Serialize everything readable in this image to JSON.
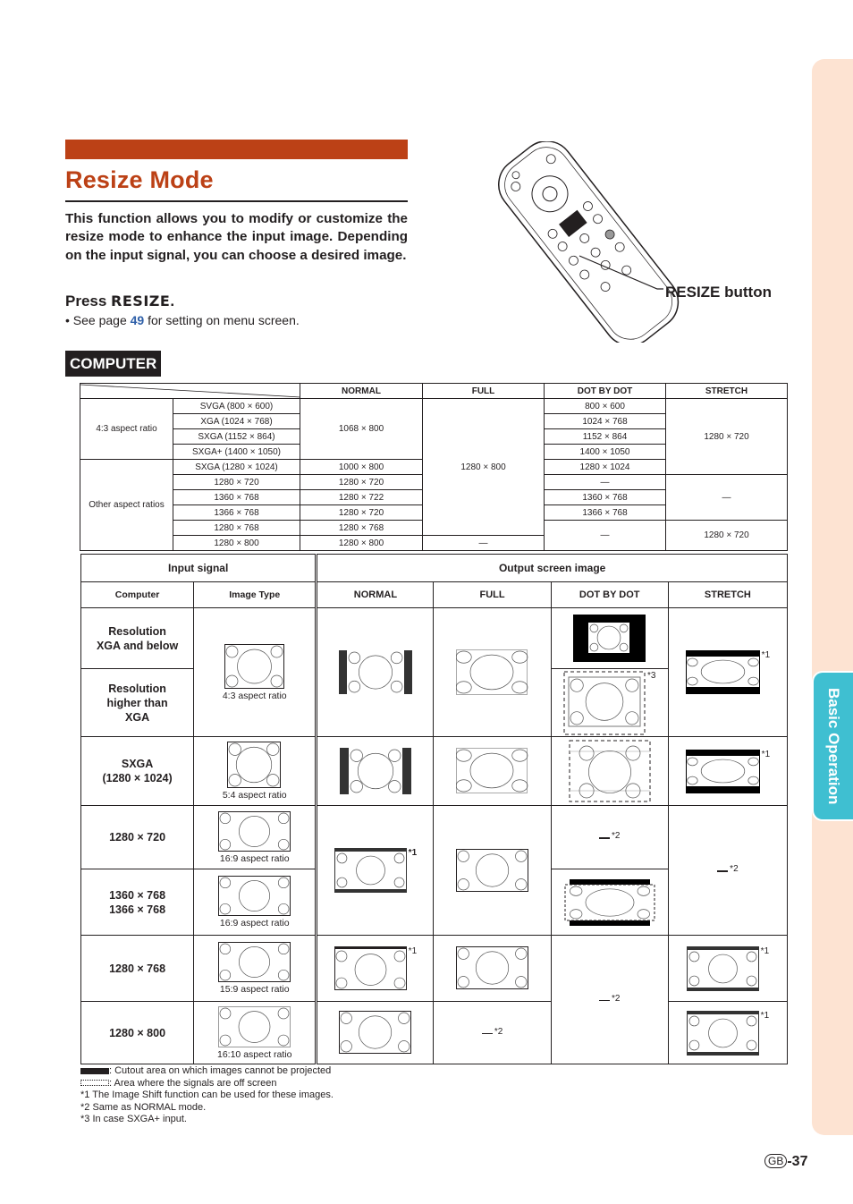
{
  "page": {
    "title": "Resize Mode",
    "intro": "This function allows you to modify or customize the resize mode to enhance the input image. Depending on the input signal, you can choose a desired image.",
    "press_prefix": "Press ",
    "press_key": "RESIZE",
    "press_suffix": ".",
    "see_prefix": "• See page ",
    "see_page": "49",
    "see_suffix": " for setting on menu screen.",
    "remote_callout": "RESIZE button",
    "section_label": "COMPUTER",
    "side_tab": "Basic Operation",
    "page_region": "GB",
    "page_number": "-37",
    "colors": {
      "accent": "#bc4116",
      "tab": "#3fbfd1",
      "tab_bg": "#fde3d2",
      "link": "#2e5fa8"
    }
  },
  "spec_table": {
    "headers": [
      "NORMAL",
      "FULL",
      "DOT BY DOT",
      "STRETCH"
    ],
    "groups": [
      {
        "label": "4:3 aspect ratio",
        "rows": [
          {
            "signal": "SVGA (800 × 600)",
            "normal": "1068 × 800",
            "dot": "800 × 600",
            "stretch": "1280 × 720"
          },
          {
            "signal": "XGA (1024 × 768)",
            "dot": "1024 × 768"
          },
          {
            "signal": "SXGA (1152 × 864)",
            "dot": "1152 × 864"
          },
          {
            "signal": "SXGA+ (1400 × 1050)",
            "dot": "1400 × 1050"
          }
        ]
      },
      {
        "label": "Other aspect ratios",
        "rows": [
          {
            "signal": "SXGA (1280 × 1024)",
            "normal": "1000 × 800",
            "dot": "1280 × 1024"
          },
          {
            "signal": "1280 × 720",
            "normal": "1280 × 720",
            "dot": "—",
            "stretch": "—"
          },
          {
            "signal": "1360 × 768",
            "normal": "1280 × 722",
            "dot": "1360 × 768"
          },
          {
            "signal": "1366 × 768",
            "normal": "1280 × 720",
            "dot": "1366 × 768"
          },
          {
            "signal": "1280 × 768",
            "normal": "1280 × 768",
            "dot": "—",
            "stretch": "1280 × 720"
          },
          {
            "signal": "1280 × 800",
            "normal": "1280 × 800",
            "full": "—"
          }
        ]
      }
    ],
    "full_merged": "1280 × 800"
  },
  "image_table": {
    "input_header": "Input signal",
    "output_header": "Output screen image",
    "sub_headers": [
      "Computer",
      "Image Type",
      "NORMAL",
      "FULL",
      "DOT BY DOT",
      "STRETCH"
    ],
    "rows": [
      {
        "label": "Resolution\nXGA and below"
      },
      {
        "label": "Resolution\nhigher than\nXGA"
      },
      {
        "label": "SXGA\n(1280 × 1024)"
      },
      {
        "label": "1280 × 720"
      },
      {
        "label": "1360 × 768\n1366 × 768"
      },
      {
        "label": "1280 × 768"
      },
      {
        "label": "1280 × 800"
      }
    ],
    "image_types": [
      "4:3 aspect ratio",
      "5:4 aspect ratio",
      "16:9 aspect ratio",
      "16:9 aspect ratio",
      "15:9 aspect ratio",
      "16:10 aspect ratio"
    ],
    "notes": {
      "n1": "*1",
      "n2": "*2",
      "n3": "*3"
    }
  },
  "legend": {
    "black": ": Cutout area on which images cannot be projected",
    "dotted": ": Area where the signals are off screen",
    "note1": "*1 The Image Shift function can be used for these images.",
    "note2": "*2 Same as NORMAL mode.",
    "note3": "*3 In case SXGA+ input."
  }
}
